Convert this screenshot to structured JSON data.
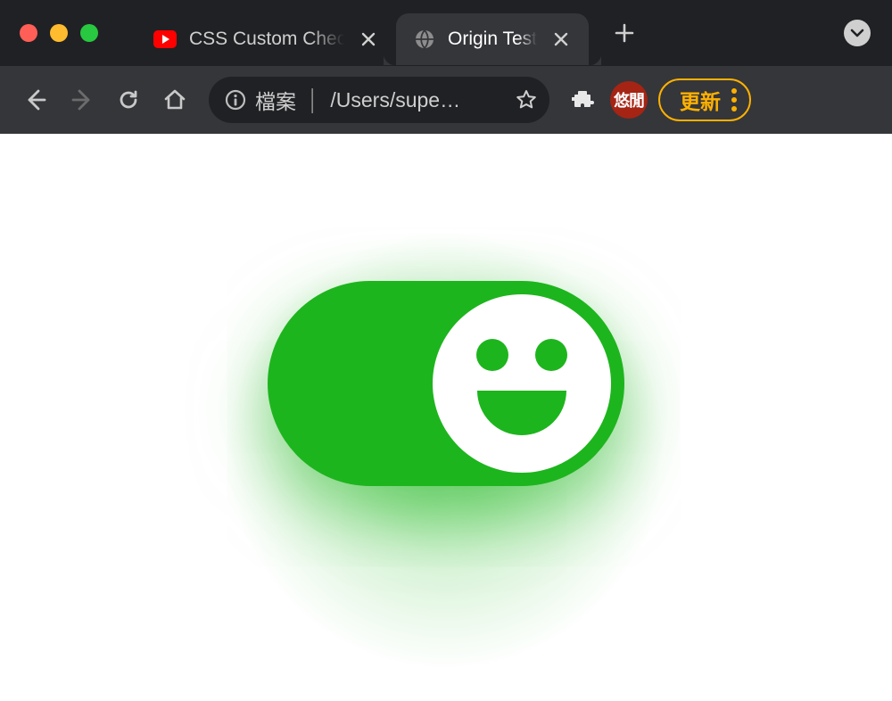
{
  "tabs": [
    {
      "title": "CSS Custom Checkbox",
      "favicon": "youtube-icon",
      "active": false
    },
    {
      "title": "Origin Test",
      "favicon": "globe-icon",
      "active": true
    }
  ],
  "toolbar": {
    "omnibox": {
      "scheme_label": "檔案",
      "path": "/Users/supe…"
    },
    "extension_badge_text": "悠閒",
    "update_label": "更新"
  },
  "page": {
    "toggle_state": "on",
    "accent_color": "#1db51d"
  }
}
